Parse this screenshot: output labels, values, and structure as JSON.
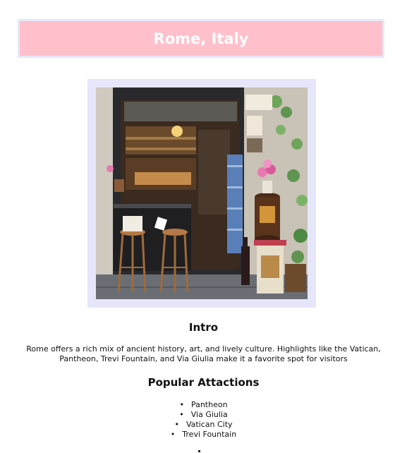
{
  "header": {
    "title": "Rome, Italy",
    "background_color": "#ffc0cb",
    "border_color": "#e6e6fa",
    "title_color": "#ffffff"
  },
  "photo": {
    "frame_color": "#e6e6fa",
    "subject": "storefront-photo"
  },
  "intro": {
    "heading": "Intro",
    "text": "Rome offers a rich mix of ancient history, art, and lively culture. Highlights like the Vatican, Pantheon, Trevi Fountain, and Via Giulia make it a favorite spot for visitors"
  },
  "attractions": {
    "heading": "Popular Attactions",
    "items": [
      "Pantheon",
      "Via Giulia",
      "Vatican City",
      "Trevi Fountain"
    ]
  }
}
